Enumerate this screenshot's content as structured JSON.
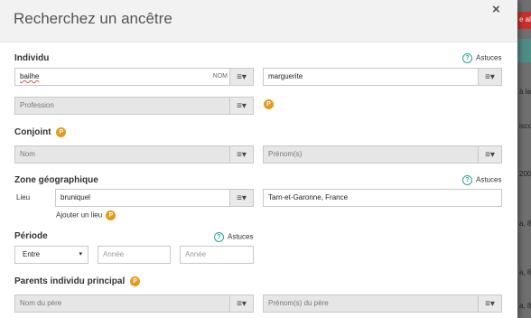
{
  "modal": {
    "title": "Recherchez un ancêtre",
    "close_glyph": "×"
  },
  "background": {
    "lines": [
      "e al",
      "à la",
      "isco",
      "200",
      "a, 8",
      "a, 8",
      "a, 8"
    ]
  },
  "individu": {
    "section_label": "Individu",
    "hint": "Astuces",
    "nom_value": "bailhe",
    "nom_suffix": "NOM",
    "prenom_value": "marguerite",
    "profession_placeholder": "Profession",
    "premium_badge": "P"
  },
  "conjoint": {
    "section_label": "Conjoint",
    "premium_badge": "P",
    "nom_placeholder": "Nom",
    "prenom_placeholder": "Prénom(s)"
  },
  "zone": {
    "section_label": "Zone géographique",
    "hint": "Astuces",
    "lieu_label": "Lieu",
    "lieu_value": "bruniquel",
    "lieu_detail_value": "Tarn-et-Garonne, France",
    "add_place_link": "Ajouter un lieu",
    "premium_badge": "P"
  },
  "periode": {
    "section_label": "Période",
    "hint": "Astuces",
    "mode_selected": "Entre",
    "annee1_placeholder": "Année",
    "annee2_placeholder": "Année"
  },
  "parents": {
    "section_label": "Parents individu principal",
    "premium_badge": "P",
    "pere_nom_placeholder": "Nom du père",
    "pere_prenom_placeholder": "Prénom(s) du père"
  },
  "colors": {
    "accent_help": "#2aa198",
    "premium": "#e49a1c",
    "disabled_bg": "#e6e6e6"
  },
  "icons": {
    "menu": "≡▾",
    "help": "?",
    "dropdown": "▾"
  }
}
